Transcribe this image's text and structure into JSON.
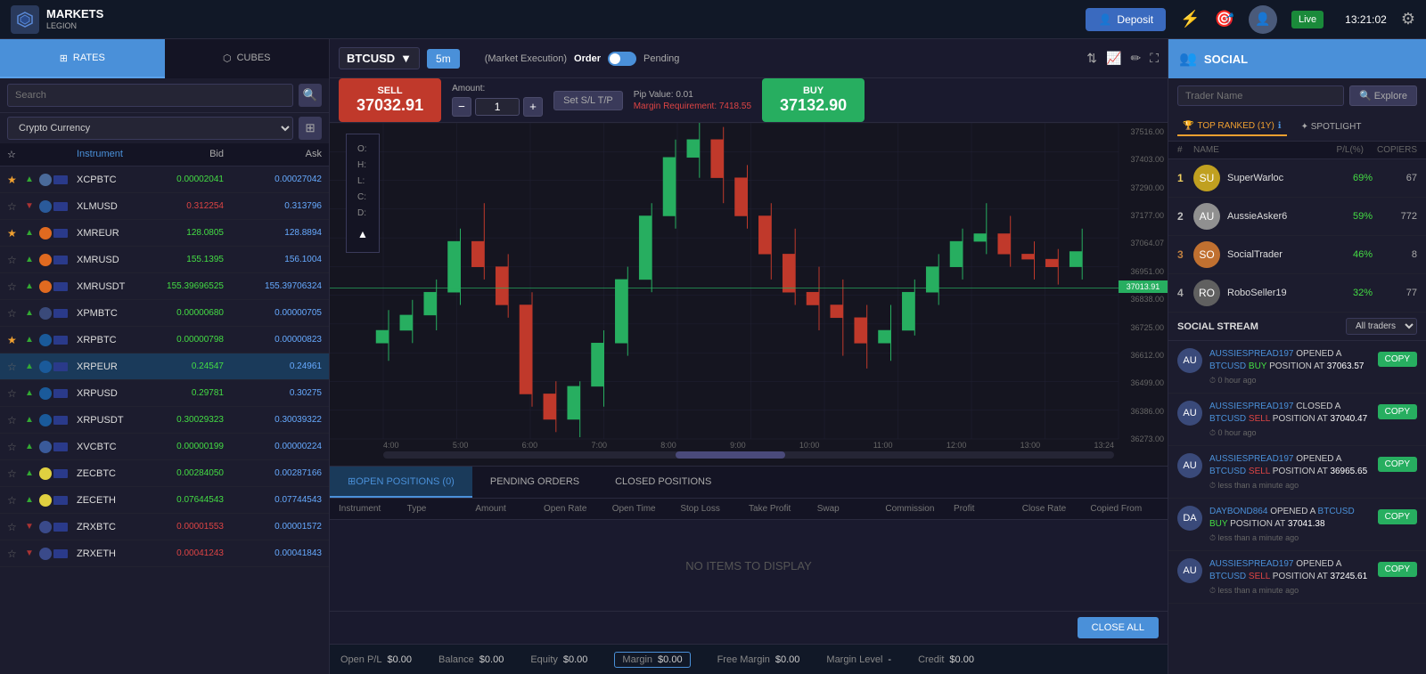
{
  "app": {
    "logo_text": "MARKETS\nLEGION",
    "brand_top": "MARKETS",
    "brand_bottom": "LEGION",
    "time": "13:21:02",
    "live_label": "Live"
  },
  "top_nav": {
    "deposit_label": "Deposit",
    "settings_icon": "⚙",
    "lightning_icon": "⚡",
    "refresh_icon": "↻"
  },
  "left_panel": {
    "rates_tab": "RATES",
    "cubes_tab": "CUBES",
    "search_placeholder": "Search",
    "category": "Crypto Currency",
    "instruments": [
      {
        "name": "XCPBTC",
        "bid": "0.00002041",
        "ask": "0.00027042",
        "star": true,
        "trend": "up"
      },
      {
        "name": "XLMUSD",
        "bid": "0.312254",
        "ask": "0.313796",
        "star": false,
        "trend": "down"
      },
      {
        "name": "XMREUR",
        "bid": "128.0805",
        "ask": "128.8894",
        "star": true,
        "trend": "up"
      },
      {
        "name": "XMRUSD",
        "bid": "155.1395",
        "ask": "156.1004",
        "star": false,
        "trend": "up"
      },
      {
        "name": "XMRUSDT",
        "bid": "155.39696525",
        "ask": "155.39706324",
        "star": false,
        "trend": "up"
      },
      {
        "name": "XPMBTC",
        "bid": "0.00000680",
        "ask": "0.00000705",
        "star": false,
        "trend": "up"
      },
      {
        "name": "XRPBTC",
        "bid": "0.00000798",
        "ask": "0.00000823",
        "star": true,
        "trend": "up"
      },
      {
        "name": "XRPEUR",
        "bid": "0.24547",
        "ask": "0.24961",
        "star": false,
        "trend": "up",
        "selected": true
      },
      {
        "name": "XRPUSD",
        "bid": "0.29781",
        "ask": "0.30275",
        "star": false,
        "trend": "up"
      },
      {
        "name": "XRPUSDT",
        "bid": "0.30029323",
        "ask": "0.30039322",
        "star": false,
        "trend": "up"
      },
      {
        "name": "XVCBTC",
        "bid": "0.00000199",
        "ask": "0.00000224",
        "star": false,
        "trend": "up"
      },
      {
        "name": "ZECBTC",
        "bid": "0.00284050",
        "ask": "0.00287166",
        "star": false,
        "trend": "up"
      },
      {
        "name": "ZECETH",
        "bid": "0.07644543",
        "ask": "0.07744543",
        "star": false,
        "trend": "up"
      },
      {
        "name": "ZRXBTC",
        "bid": "0.00001553",
        "ask": "0.00001572",
        "star": false,
        "trend": "down"
      },
      {
        "name": "ZRXETH",
        "bid": "0.00041243",
        "ask": "0.00041843",
        "star": false,
        "trend": "down"
      }
    ],
    "col_instrument": "Instrument",
    "col_bid": "Bid",
    "col_ask": "Ask"
  },
  "chart": {
    "pair": "BTCUSD",
    "timeframe": "5m",
    "order_label": "Order",
    "pending_label": "Pending",
    "market_exec": "(Market Execution)",
    "sell_label": "SELL",
    "sell_price": "37032.91",
    "buy_label": "BUY",
    "buy_price": "37132.90",
    "amount_label": "Amount:",
    "amount_value": "1",
    "set_sl_tp": "Set S/L T/P",
    "pip_value": "Pip Value: 0.01",
    "margin_req": "Margin Requirement: 7418.55",
    "ohlc": {
      "o": "O:",
      "h": "H:",
      "l": "L:",
      "c": "C:",
      "d": "D:"
    },
    "y_labels": [
      "37516.00",
      "37403.00",
      "37290.00",
      "37177.00",
      "37064.07",
      "36951.00",
      "36838.00",
      "36725.00",
      "36612.00",
      "36499.00",
      "36386.00",
      "36273.00"
    ],
    "x_labels": [
      "4:00",
      "5:00",
      "6:00",
      "7:00",
      "8:00",
      "9:00",
      "10:00",
      "11:00",
      "12:00",
      "13:00",
      "13:24"
    ],
    "current_price": "37013.91"
  },
  "positions": {
    "open_tab": "OPEN POSITIONS (0)",
    "pending_tab": "PENDING ORDERS",
    "closed_tab": "CLOSED POSITIONS",
    "cols": [
      "Instrument",
      "Type",
      "Amount",
      "Open Rate",
      "Open Time",
      "Stop Loss",
      "Take Profit",
      "Swap",
      "Commission",
      "Profit",
      "Close Rate",
      "Copied From"
    ],
    "no_items": "NO ITEMS TO DISPLAY",
    "close_all": "CLOSE ALL"
  },
  "status_bar": {
    "open_pl_label": "Open P/L",
    "open_pl_value": "$0.00",
    "balance_label": "Balance",
    "balance_value": "$0.00",
    "equity_label": "Equity",
    "equity_value": "$0.00",
    "margin_label": "Margin",
    "margin_value": "$0.00",
    "free_margin_label": "Free Margin",
    "free_margin_value": "$0.00",
    "margin_level_label": "Margin Level",
    "margin_level_value": "-",
    "credit_label": "Credit",
    "credit_value": "$0.00"
  },
  "social": {
    "title": "SOCIAL",
    "search_placeholder": "Trader Name",
    "explore_label": "🔍 Explore",
    "top_ranked_label": "TOP RANKED (1Y)",
    "spotlight_label": "✦ SPOTLIGHT",
    "col_name": "NAME",
    "col_pl": "P/L(%)",
    "col_copiers": "COPIERS",
    "traders": [
      {
        "rank": 1,
        "name": "SuperWarloc",
        "pl": "69%",
        "copiers": "67",
        "color": "#c0a020"
      },
      {
        "rank": 2,
        "name": "AussieAsker6",
        "pl": "59%",
        "copiers": "772",
        "color": "#909090"
      },
      {
        "rank": 3,
        "name": "SocialTrader",
        "pl": "46%",
        "copiers": "8",
        "color": "#c07030"
      },
      {
        "rank": 4,
        "name": "RoboSeller19",
        "pl": "32%",
        "copiers": "77",
        "color": "#606060"
      }
    ],
    "stream_title": "SOCIAL STREAM",
    "all_traders_label": "All traders",
    "stream_items": [
      {
        "user": "AUSSIESPREAD197",
        "action": "OPENED A",
        "pair": "BTCUSD",
        "direction": "BUY",
        "text": "POSITION AT",
        "price": "37063.57",
        "time": "0 hour ago",
        "copy_label": "COPY"
      },
      {
        "user": "AUSSIESPREAD197",
        "action": "CLOSED A",
        "pair": "BTCUSD",
        "direction": "SELL",
        "text": "POSITION AT",
        "price": "37040.47",
        "time": "0 hour ago",
        "copy_label": "COPY"
      },
      {
        "user": "AUSSIESPREAD197",
        "action": "OPENED A",
        "pair": "BTCUSD",
        "direction": "SELL",
        "text": "POSITION AT",
        "price": "36965.65",
        "time": "less than a minute ago",
        "copy_label": "COPY"
      },
      {
        "user": "DAYBOND864",
        "action": "OPENED A",
        "pair": "BTCUSD",
        "direction": "BUY",
        "text": "POSITION AT",
        "price": "37041.38",
        "time": "less than a minute ago",
        "copy_label": "COPY"
      },
      {
        "user": "AUSSIESPREAD197",
        "action": "OPENED A",
        "pair": "BTCUSD",
        "direction": "SELL",
        "text": "POSITION AT",
        "price": "37245.61",
        "time": "less than a minute ago",
        "copy_label": "COPY"
      }
    ]
  }
}
